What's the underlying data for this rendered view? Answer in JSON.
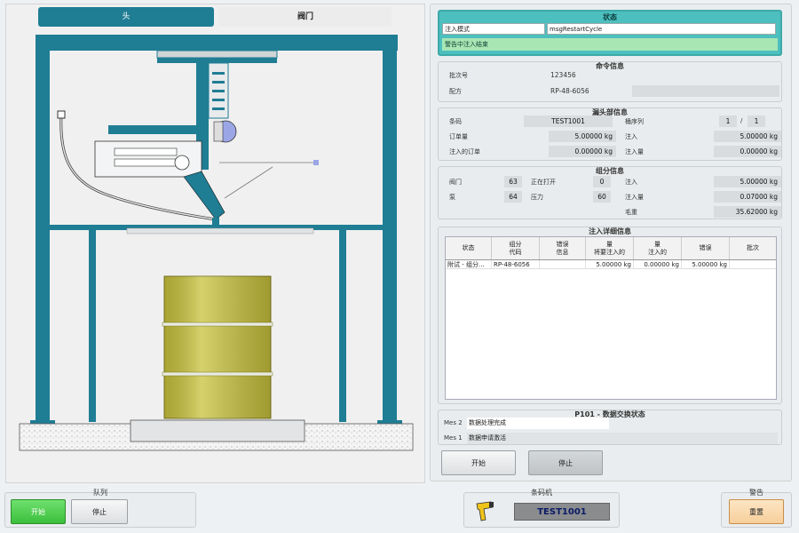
{
  "tabs": {
    "head": "头",
    "valve": "阀门"
  },
  "status": {
    "title": "状态",
    "mode_label": "注入模式",
    "mode_value": "msgRestartCycle",
    "warning": "警告中注入结束"
  },
  "command": {
    "title": "命令信息",
    "batch_label": "批次号",
    "batch_value": "123456",
    "recipe_label": "配方",
    "recipe_value": "RP-48-6056"
  },
  "nozzle": {
    "title": "漏头部信息",
    "barcode_label": "条码",
    "barcode_value": "TEST1001",
    "seq_label": "桶序列",
    "seq_value": "1",
    "seq_sep": "/",
    "seq_total": "1",
    "order_label": "订单量",
    "order_value": "5.00000 kg",
    "inject_label": "注入",
    "inject_value": "5.00000 kg",
    "injected_order_label": "注入的订单",
    "injected_order_value": "0.00000 kg",
    "inject_amount_label": "注入量",
    "inject_amount_value": "0.00000 kg"
  },
  "component": {
    "title": "组分信息",
    "valve_label": "阀门",
    "valve_value": "63",
    "opening_label": "正在打开",
    "opening_value": "0",
    "inject_label": "注入",
    "inject_value": "5.00000 kg",
    "pump_label": "泵",
    "pump_value": "64",
    "pressure_label": "压力",
    "pressure_value": "60",
    "inject_amount_label": "注入量",
    "inject_amount_value": "0.07000 kg",
    "gross_label": "毛重",
    "gross_value": "35.62000 kg"
  },
  "detail": {
    "title": "注入详细信息",
    "columns": [
      "状态",
      "组分\n代码",
      "错误\n信息",
      "量\n将要注入的",
      "量\n注入的",
      "错误",
      "批次"
    ],
    "rows": [
      [
        "附试 - 组分...",
        "RP-48-6056",
        "",
        "5.00000 kg",
        "0.00000 kg",
        "5.00000 kg",
        ""
      ]
    ]
  },
  "exchange": {
    "title": "P101 - 数据交换状态",
    "mes2_label": "Mes 2",
    "mes2_value": "数据处理完成",
    "mes1_label": "Mes 1",
    "mes1_value": "数据申请激活"
  },
  "actions": {
    "start": "开始",
    "stop": "停止"
  },
  "queue": {
    "title": "队列",
    "start": "开始",
    "stop": "停止"
  },
  "barcode_scanner": {
    "title": "条码机",
    "value": "TEST1001"
  },
  "alarm": {
    "title": "警告",
    "reset": "重置"
  },
  "colors": {
    "frame": "#1f7d94",
    "drum": "#c8c23c",
    "status_bg": "#4dbfbf",
    "warning_bg": "#a8e6b4",
    "start_green": "#3cbf3c",
    "reset_orange": "#f6cf9b",
    "barcode_text": "#0b1a66"
  }
}
